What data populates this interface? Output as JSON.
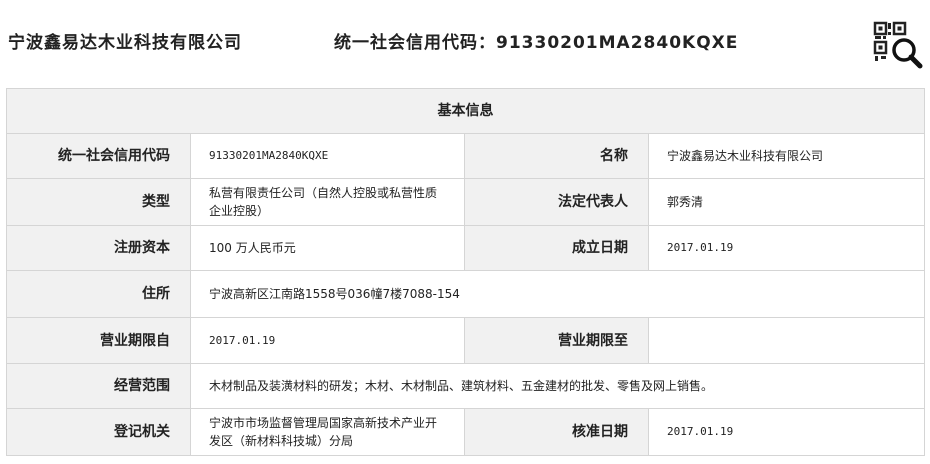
{
  "header": {
    "company_name": "宁波鑫易达木业科技有限公司",
    "credit_code_label": "统一社会信用代码：",
    "credit_code_value": "91330201MA2840KQXE"
  },
  "table": {
    "title": "基本信息",
    "labels": {
      "credit_code": "统一社会信用代码",
      "name": "名称",
      "type": "类型",
      "legal_rep": "法定代表人",
      "capital": "注册资本",
      "established": "成立日期",
      "address": "住所",
      "term_from": "营业期限自",
      "term_to": "营业期限至",
      "scope": "经营范围",
      "authority": "登记机关",
      "approved": "核准日期"
    },
    "values": {
      "credit_code": "91330201MA2840KQXE",
      "name": "宁波鑫易达木业科技有限公司",
      "type": "私营有限责任公司（自然人控股或私营性质企业控股）",
      "legal_rep": "郭秀清",
      "capital": "100 万人民币元",
      "established": "2017.01.19",
      "address": "宁波高新区江南路1558号036幢7楼7088-154",
      "term_from": "2017.01.19",
      "term_to": "",
      "scope": "木材制品及装潢材料的研发；木材、木材制品、建筑材料、五金建材的批发、零售及网上销售。",
      "authority": "宁波市市场监督管理局国家高新技术产业开发区（新材料科技城）分局",
      "approved": "2017.01.19"
    }
  },
  "icons": {
    "qr": "qr-search-icon"
  }
}
